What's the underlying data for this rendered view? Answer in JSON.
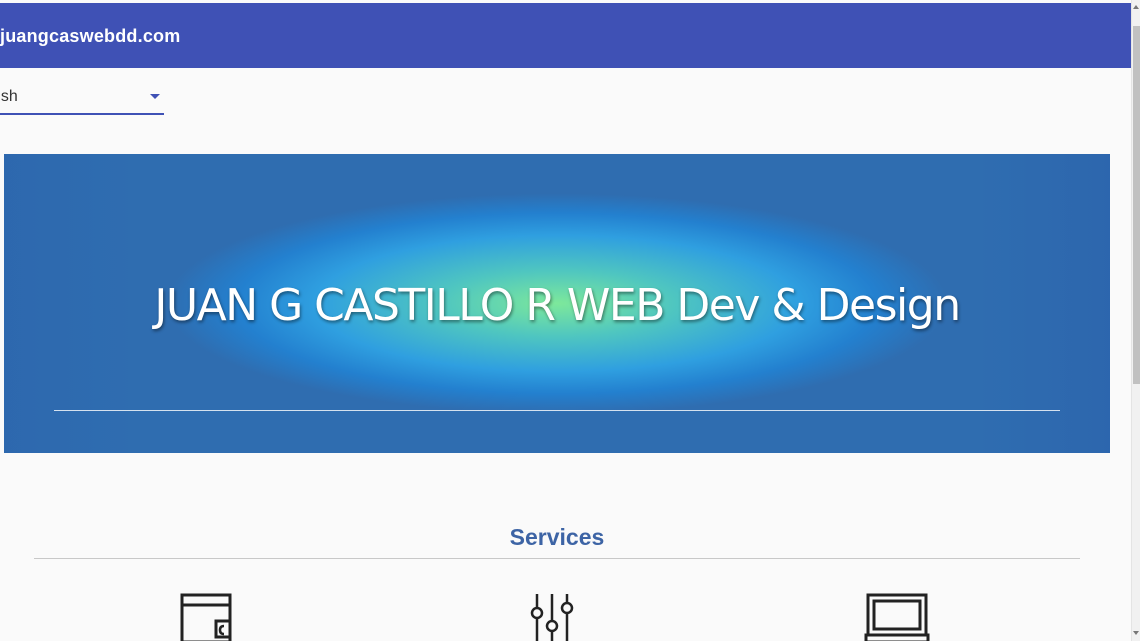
{
  "toolbar": {
    "title": "juangcaswebdd.com"
  },
  "language_select": {
    "value": "nglish"
  },
  "hero": {
    "title": "JUAN G CASTILLO R WEB Dev & Design"
  },
  "services": {
    "heading": "Services",
    "icons": [
      "wallet-icon",
      "sliders-icon",
      "laptop-icon"
    ]
  },
  "colors": {
    "toolbar": "#3f51b5",
    "services_heading": "#3d64a5",
    "hero_center": "#7de89b",
    "hero_edge": "#2f6db0"
  }
}
